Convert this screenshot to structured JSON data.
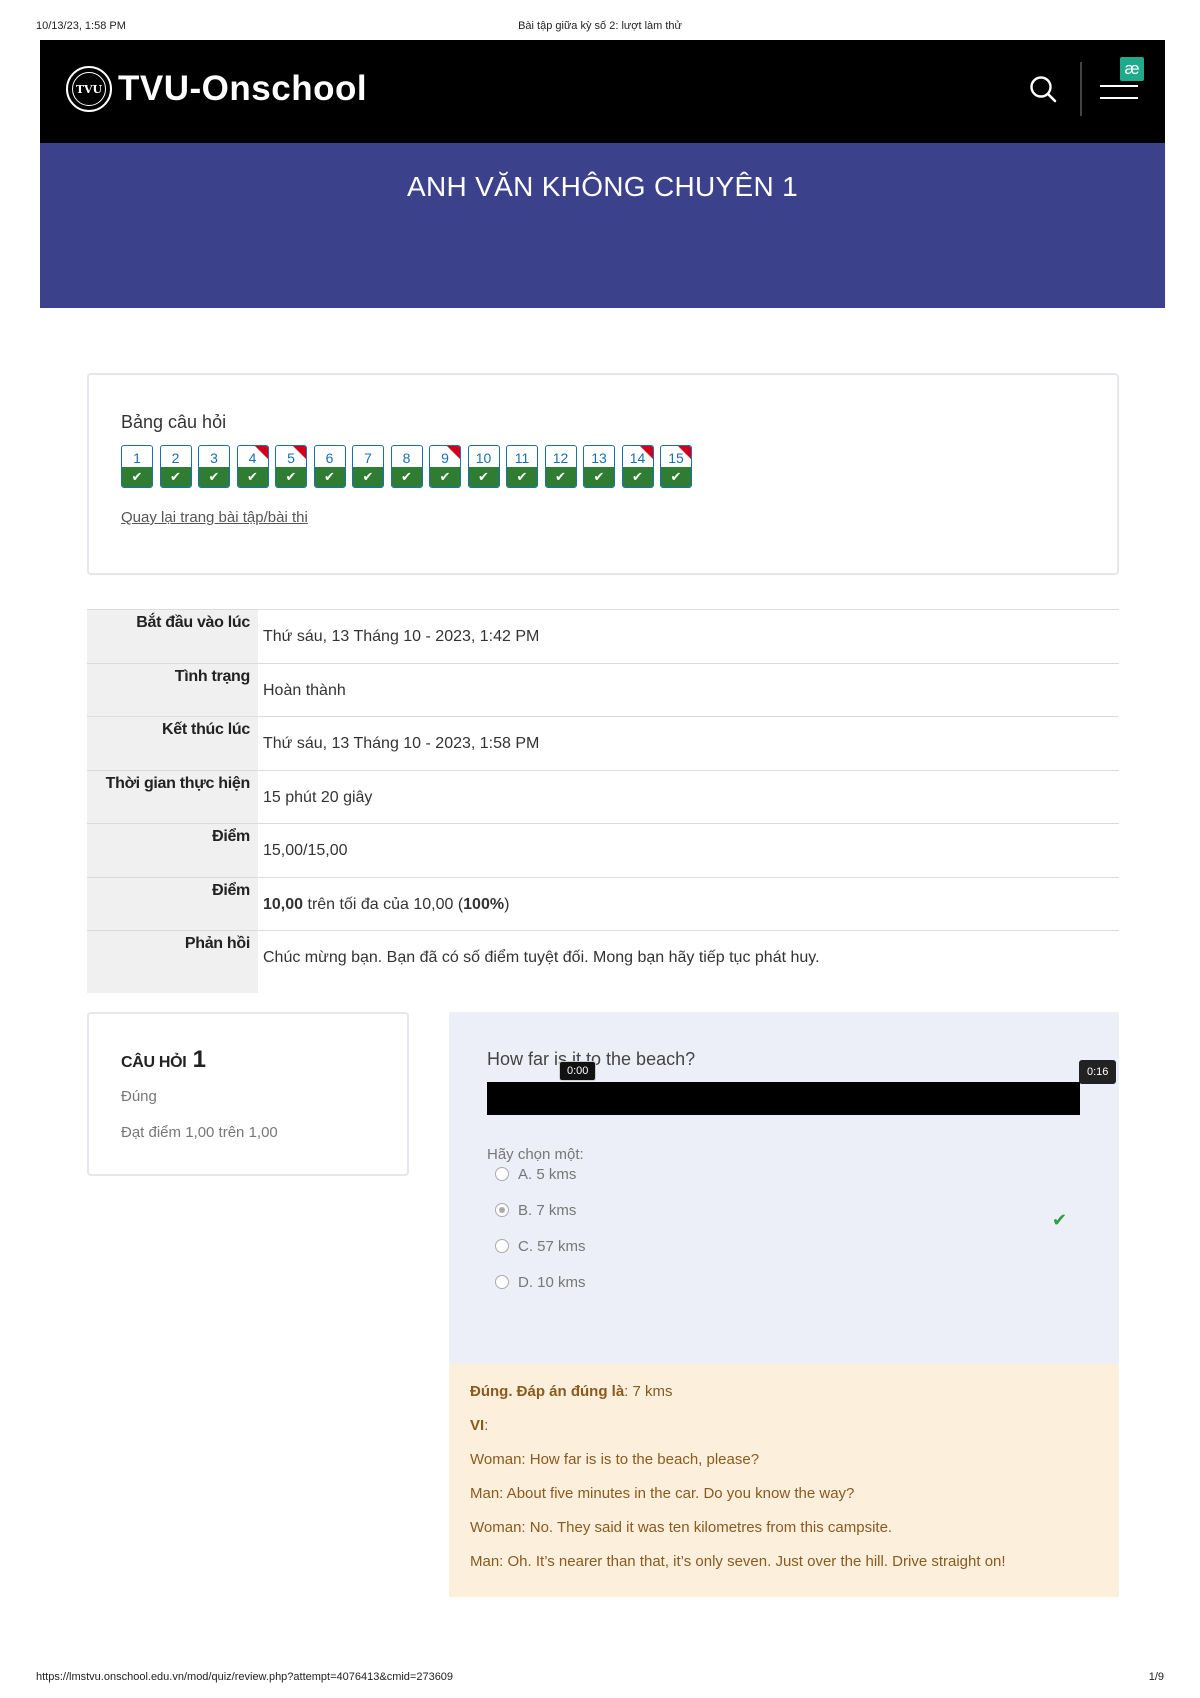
{
  "print": {
    "datetime": "10/13/23, 1:58 PM",
    "doc_title": "Bài tập giữa kỳ số 2: lượt làm thử",
    "url": "https://lmstvu.onschool.edu.vn/mod/quiz/review.php?attempt=4076413&cmid=273609",
    "page": "1/9"
  },
  "navbar": {
    "logo_text": "TVU",
    "brand": "TVU-Onschool",
    "ae_badge": "æ"
  },
  "banner": {
    "course_title": "ANH VĂN KHÔNG CHUYÊN 1"
  },
  "quiz_nav": {
    "title": "Bảng câu hỏi",
    "questions": [
      {
        "num": "1",
        "flagged": false
      },
      {
        "num": "2",
        "flagged": false
      },
      {
        "num": "3",
        "flagged": false
      },
      {
        "num": "4",
        "flagged": true
      },
      {
        "num": "5",
        "flagged": true
      },
      {
        "num": "6",
        "flagged": false
      },
      {
        "num": "7",
        "flagged": false
      },
      {
        "num": "8",
        "flagged": false
      },
      {
        "num": "9",
        "flagged": true
      },
      {
        "num": "10",
        "flagged": false
      },
      {
        "num": "11",
        "flagged": false
      },
      {
        "num": "12",
        "flagged": false
      },
      {
        "num": "13",
        "flagged": false
      },
      {
        "num": "14",
        "flagged": true
      },
      {
        "num": "15",
        "flagged": true
      }
    ],
    "back_link": "Quay lại trang bài tập/bài thi"
  },
  "summary": {
    "started_label": "Bắt đầu vào lúc",
    "started_value": "Thứ sáu, 13 Tháng 10 - 2023, 1:42 PM",
    "state_label": "Tình trạng",
    "state_value": "Hoàn thành",
    "completed_label": "Kết thúc lúc",
    "completed_value": "Thứ sáu, 13 Tháng 10 - 2023, 1:58 PM",
    "duration_label": "Thời gian thực hiện",
    "duration_value": "15 phút 20 giây",
    "marks_label": "Điểm",
    "marks_value": "15,00/15,00",
    "grade_label": "Điểm",
    "grade_score": "10,00",
    "grade_middle": " trên tối đa của 10,00 (",
    "grade_percent": "100%",
    "grade_end": ")",
    "feedback_label": "Phản hồi",
    "feedback_value": "Chúc mừng bạn. Bạn đã có số điểm tuyệt đối. Mong bạn hãy tiếp tục phát huy."
  },
  "question": {
    "label": "CÂU HỎI",
    "number": "1",
    "state": "Đúng",
    "grade": "Đạt điểm 1,00 trên 1,00",
    "prompt": "How far is it to the beach?",
    "audio_time_start": "0:00",
    "audio_time_end": "0:16",
    "choose_label": "Hãy chọn một:",
    "answers": [
      {
        "text": "A. 5 kms",
        "checked": false
      },
      {
        "text": "B. 7 kms",
        "checked": true
      },
      {
        "text": "C. 57 kms",
        "checked": false
      },
      {
        "text": "D. 10 kms",
        "checked": false
      }
    ],
    "correct_icon": "check-icon"
  },
  "feedback": {
    "right_label": "Đúng. Đáp án đúng là",
    "right_value": ": 7 kms",
    "vi_label": "VI",
    "vi_colon": ":",
    "lines": [
      "Woman: How far is is to the beach, please?",
      "Man: About five minutes in the car. Do you know the way?",
      "Woman: No. They said it was ten kilometres from this campsite.",
      "Man: Oh. It’s nearer than that, it’s only seven. Just over the hill. Drive straight on!"
    ]
  },
  "colors": {
    "navbar": "#000000",
    "banner": "#3c418c",
    "answered": "#2e7d32",
    "flag": "#d0021b",
    "question_bg": "#eceff7",
    "feedback_bg": "#fcefdc",
    "ae_badge": "#1faa8c"
  }
}
